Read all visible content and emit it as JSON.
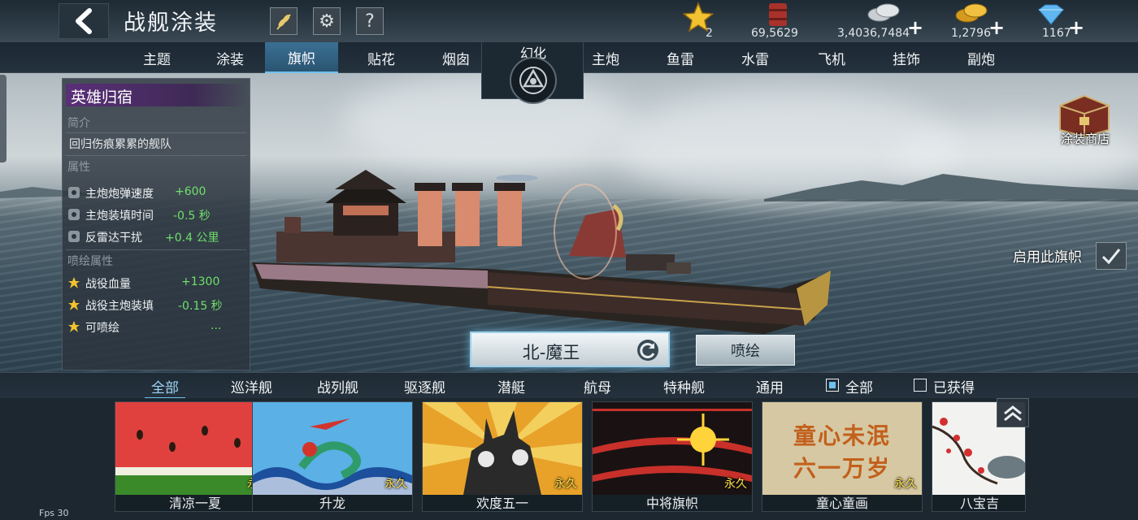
{
  "header": {
    "title": "战舰涂装",
    "help_glyph": "?",
    "resources": [
      {
        "icon": "star-icon",
        "value": "2"
      },
      {
        "icon": "oil-barrel-icon",
        "value": "69,5629"
      },
      {
        "icon": "silver-coins-icon",
        "value": "3,4036,7484"
      },
      {
        "icon": "gold-coins-icon",
        "value": "1,2796"
      },
      {
        "icon": "diamond-icon",
        "value": "1167"
      }
    ],
    "plus_glyph": "+"
  },
  "tabs": {
    "left": [
      "主题",
      "涂装",
      "旗帜",
      "贴花",
      "烟囱"
    ],
    "center": "幻化",
    "right": [
      "主炮",
      "鱼雷",
      "水雷",
      "飞机",
      "挂饰",
      "副炮"
    ],
    "active": "旗帜"
  },
  "info": {
    "name": "英雄归宿",
    "intro_label": "简介",
    "description": "回归伤痕累累的舰队",
    "attr_label": "属性",
    "attributes": [
      {
        "label": "主炮炮弹速度",
        "value": "+600"
      },
      {
        "label": "主炮装填时间",
        "value": "-0.5 秒"
      },
      {
        "label": "反雷达干扰",
        "value": "+0.4 公里"
      }
    ],
    "paint_attr_label": "喷绘属性",
    "paint_attributes": [
      {
        "label": "战役血量",
        "value": "+1300"
      },
      {
        "label": "战役主炮装填",
        "value": "-0.15 秒"
      },
      {
        "label": "可喷绘",
        "value": "..."
      }
    ]
  },
  "shop_label": "涂装商店",
  "flag_toggle_label": "启用此旗帜",
  "ship_name": "北-魔王",
  "paint_button": "喷绘",
  "filters": {
    "categories": [
      "全部",
      "巡洋舰",
      "战列舰",
      "驱逐舰",
      "潜艇",
      "航母",
      "特种舰",
      "通用"
    ],
    "active": "全部",
    "check_all": "全部",
    "check_owned": "已获得"
  },
  "cards": [
    {
      "name": "清凉一夏",
      "tag": "永久"
    },
    {
      "name": "升龙",
      "tag": "永久"
    },
    {
      "name": "欢度五一",
      "tag": "永久"
    },
    {
      "name": "中将旗帜",
      "tag": "永久"
    },
    {
      "name": "童心童画",
      "tag": "永久",
      "art_lines": [
        "童心未泯",
        "六一万岁"
      ]
    },
    {
      "name": "八宝吉"
    }
  ],
  "fps": "Fps 30",
  "colors": {
    "accent_blue": "#6fc2ee",
    "positive_green": "#6fe06a",
    "title_purple": "#5a2f78",
    "permanent_yellow": "#ffe04a"
  }
}
